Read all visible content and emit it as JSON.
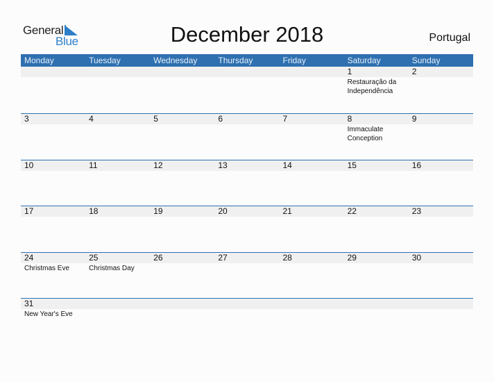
{
  "logo": {
    "general": "General",
    "blue": "Blue"
  },
  "title": "December 2018",
  "country": "Portugal",
  "colors": {
    "header_bg": "#2e70b0",
    "accent": "#2d7fc9",
    "strip_bg": "#f0f0f0"
  },
  "weekdays": [
    "Monday",
    "Tuesday",
    "Wednesday",
    "Thursday",
    "Friday",
    "Saturday",
    "Sunday"
  ],
  "weeks": [
    [
      {
        "day": "",
        "event": ""
      },
      {
        "day": "",
        "event": ""
      },
      {
        "day": "",
        "event": ""
      },
      {
        "day": "",
        "event": ""
      },
      {
        "day": "",
        "event": ""
      },
      {
        "day": "1",
        "event": "Restauração da Independência"
      },
      {
        "day": "2",
        "event": ""
      }
    ],
    [
      {
        "day": "3",
        "event": ""
      },
      {
        "day": "4",
        "event": ""
      },
      {
        "day": "5",
        "event": ""
      },
      {
        "day": "6",
        "event": ""
      },
      {
        "day": "7",
        "event": ""
      },
      {
        "day": "8",
        "event": "Immaculate Conception"
      },
      {
        "day": "9",
        "event": ""
      }
    ],
    [
      {
        "day": "10",
        "event": ""
      },
      {
        "day": "11",
        "event": ""
      },
      {
        "day": "12",
        "event": ""
      },
      {
        "day": "13",
        "event": ""
      },
      {
        "day": "14",
        "event": ""
      },
      {
        "day": "15",
        "event": ""
      },
      {
        "day": "16",
        "event": ""
      }
    ],
    [
      {
        "day": "17",
        "event": ""
      },
      {
        "day": "18",
        "event": ""
      },
      {
        "day": "19",
        "event": ""
      },
      {
        "day": "20",
        "event": ""
      },
      {
        "day": "21",
        "event": ""
      },
      {
        "day": "22",
        "event": ""
      },
      {
        "day": "23",
        "event": ""
      }
    ],
    [
      {
        "day": "24",
        "event": "Christmas Eve"
      },
      {
        "day": "25",
        "event": "Christmas Day"
      },
      {
        "day": "26",
        "event": ""
      },
      {
        "day": "27",
        "event": ""
      },
      {
        "day": "28",
        "event": ""
      },
      {
        "day": "29",
        "event": ""
      },
      {
        "day": "30",
        "event": ""
      }
    ],
    [
      {
        "day": "31",
        "event": "New Year's Eve"
      },
      {
        "day": "",
        "event": ""
      },
      {
        "day": "",
        "event": ""
      },
      {
        "day": "",
        "event": ""
      },
      {
        "day": "",
        "event": ""
      },
      {
        "day": "",
        "event": ""
      },
      {
        "day": "",
        "event": ""
      }
    ]
  ]
}
